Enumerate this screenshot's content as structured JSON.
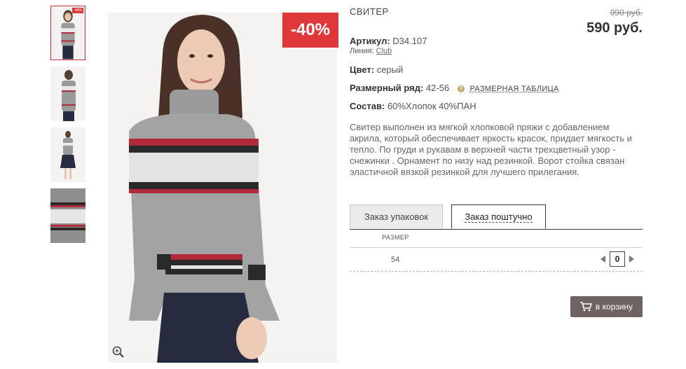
{
  "product": {
    "title": "СВИТЕР",
    "old_price": "990 руб.",
    "price": "590 руб.",
    "discount_badge": "-40%",
    "mini_badge": "-40%",
    "article_label": "Артикул:",
    "article_value": "D34.107",
    "line_label": "Линия:",
    "line_value": "Club",
    "color_label": "Цвет:",
    "color_value": "серый",
    "size_range_label": "Размерный ряд:",
    "size_range_value": "42-56",
    "size_table_link": "РАЗМЕРНАЯ ТАБЛИЦА",
    "composition_label": "Состав:",
    "composition_value": "60%Хлопок 40%ПАН",
    "description": "Свитер выполнен из мягкой хлопковой пряжи с добавлением акрила, который обеспечивает яркость красок, придает мягкость и тепло. По груди и рукавам в верхней части трехцветный узор - снежинки . Орнамент по низу над резинкой. Ворот стойка связан эластичной вязкой резинкой для лучшего прилегания."
  },
  "tabs": [
    {
      "label": "Заказ упаковок",
      "active": false
    },
    {
      "label": "Заказ поштучно",
      "active": true
    }
  ],
  "order_table": {
    "size_header": "РАЗМЕР",
    "rows": [
      {
        "size": "54",
        "quantity": "0"
      }
    ]
  },
  "cart_button": {
    "label": "в корзину",
    "icon": "cart-icon"
  },
  "icons": {
    "zoom": "zoom-icon",
    "help": "question-icon"
  },
  "colors": {
    "badge": "#e0373a",
    "button": "#6e6360",
    "active_thumb_border": "#c52f3f"
  }
}
